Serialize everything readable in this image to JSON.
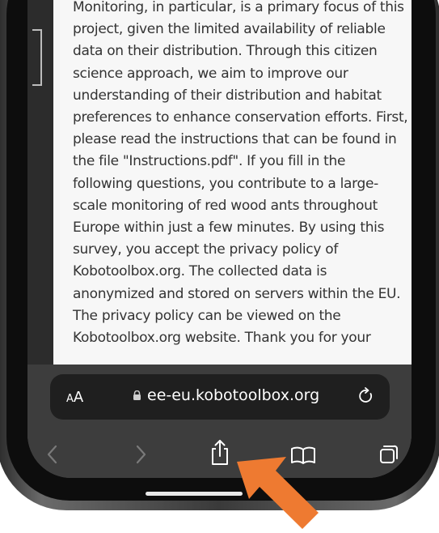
{
  "page": {
    "paragraph": "Monitoring, in particular, is a primary focus of this project, given the limited availability of reliable data on their distribution. Through this citizen science approach, we aim to improve our understanding of their distribution and habitat preferences to enhance conservation efforts. First, please read the instructions that can be found in the file \"Instructions.pdf\". If you fill in the following questions, you contribute to a large-scale monitoring of red wood ants throughout Europe within just a few minutes. By using this survey, you accept the privacy policy of Kobotoolbox.org. The collected data is anonymized and stored on servers within the EU. The privacy policy can be viewed on the Kobotoolbox.org website. Thank you for your"
  },
  "address_bar": {
    "text_size_small": "A",
    "text_size_large": "A",
    "url": "ee-eu.kobotoolbox.org"
  },
  "icons": {
    "lock": "lock-icon",
    "reload": "reload-icon",
    "back": "chevron-left-icon",
    "forward": "chevron-right-icon",
    "share": "share-icon",
    "bookmarks": "book-icon",
    "tabs": "tabs-icon"
  },
  "colors": {
    "annotation_arrow": "#ee7a31",
    "toolbar": "#3d3d3d",
    "url_pill": "#1f1f1f"
  }
}
